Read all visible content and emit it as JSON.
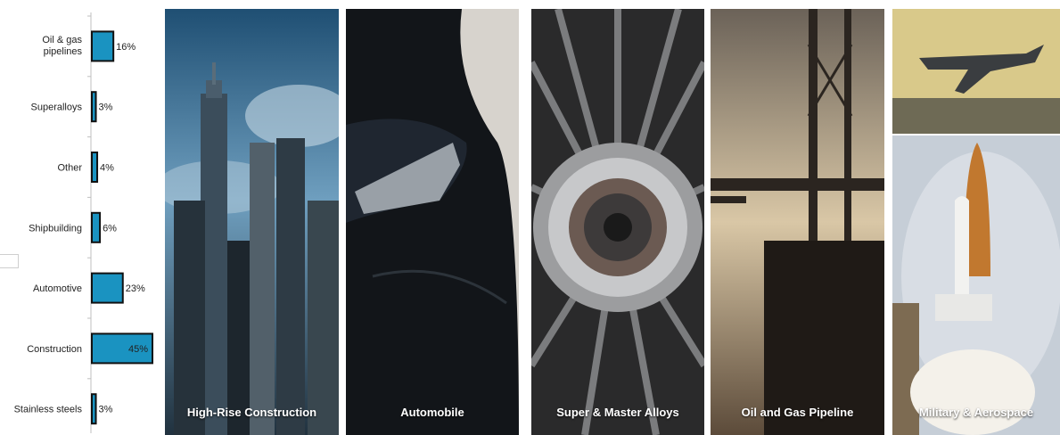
{
  "chart_data": {
    "type": "bar",
    "orientation": "horizontal",
    "categories": [
      "Oil & gas pipelines",
      "Superalloys",
      "Other",
      "Shipbuilding",
      "Automotive",
      "Construction",
      "Stainless steels"
    ],
    "values": [
      16,
      3,
      4,
      6,
      23,
      45,
      3
    ],
    "value_labels": [
      "16%",
      "3%",
      "4%",
      "6%",
      "23%",
      "45%",
      "3%"
    ],
    "xlim": [
      0,
      50
    ],
    "bar_color": "#1a93c1",
    "grid": false,
    "legend": "none"
  },
  "panels": [
    {
      "caption": "High-Rise Construction"
    },
    {
      "caption": "Automobile"
    },
    {
      "caption": "Super & Master Alloys"
    },
    {
      "caption": "Oil and Gas Pipeline"
    },
    {
      "caption": "Military & Aerospace"
    }
  ]
}
